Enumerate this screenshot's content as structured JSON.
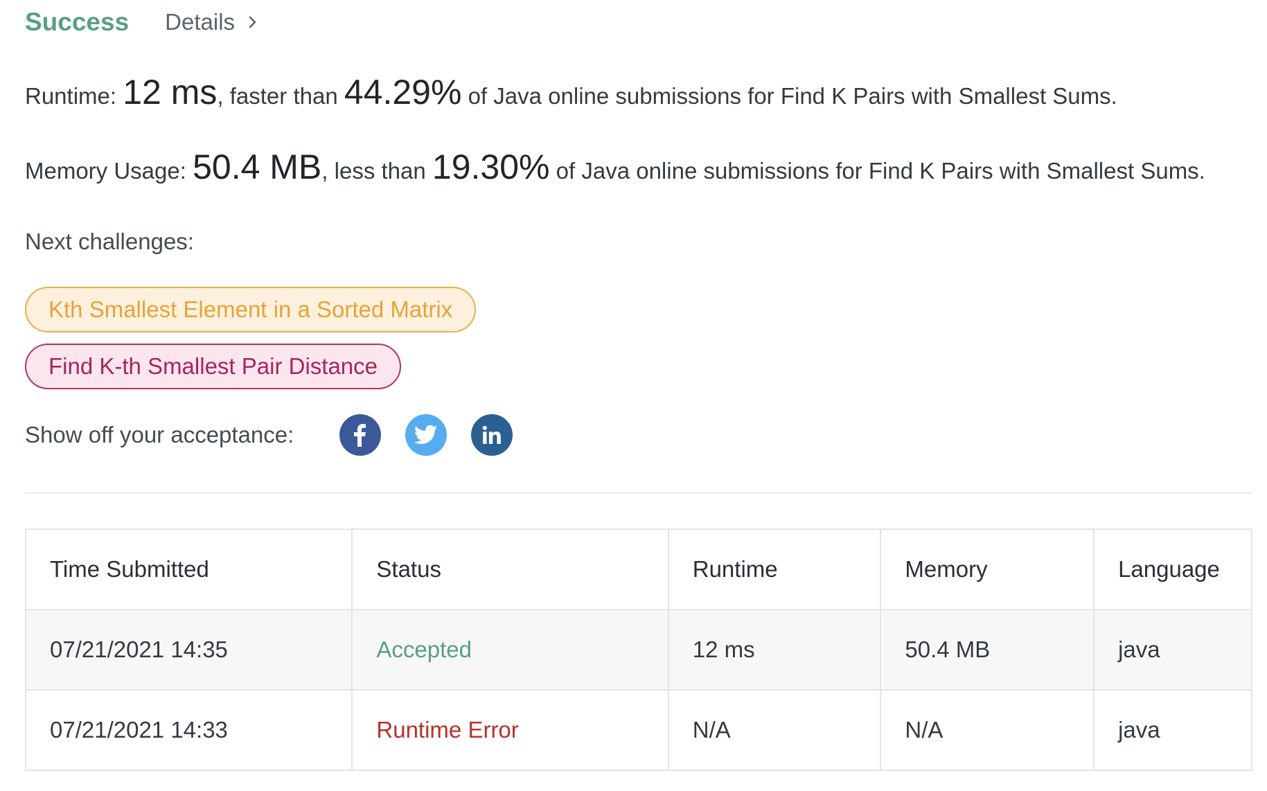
{
  "header": {
    "status": "Success",
    "details_label": "Details"
  },
  "runtime": {
    "label": "Runtime:",
    "value": "12 ms",
    "comparator": ", faster than",
    "percent": "44.29%",
    "suffix": "of Java online submissions for Find K Pairs with Smallest Sums."
  },
  "memory": {
    "label": "Memory Usage:",
    "value": "50.4 MB",
    "comparator": ", less than",
    "percent": "19.30%",
    "suffix": "of Java online submissions for Find K Pairs with Smallest Sums."
  },
  "next_challenges": {
    "label": "Next challenges:",
    "items": [
      {
        "title": "Kth Smallest Element in a Sorted Matrix",
        "color": "#e6a338"
      },
      {
        "title": "Find K-th Smallest Pair Distance",
        "color": "#a8245f"
      }
    ]
  },
  "share": {
    "label": "Show off your acceptance:",
    "icons": [
      "facebook-icon",
      "twitter-icon",
      "linkedin-icon"
    ]
  },
  "submissions": {
    "columns": [
      "Time Submitted",
      "Status",
      "Runtime",
      "Memory",
      "Language"
    ],
    "rows": [
      {
        "time": "07/21/2021 14:35",
        "status": "Accepted",
        "runtime": "12 ms",
        "memory": "50.4 MB",
        "language": "java"
      },
      {
        "time": "07/21/2021 14:33",
        "status": "Runtime Error",
        "runtime": "N/A",
        "memory": "N/A",
        "language": "java"
      }
    ]
  },
  "colors": {
    "success": "#5a9e87",
    "error": "#b5312a"
  }
}
